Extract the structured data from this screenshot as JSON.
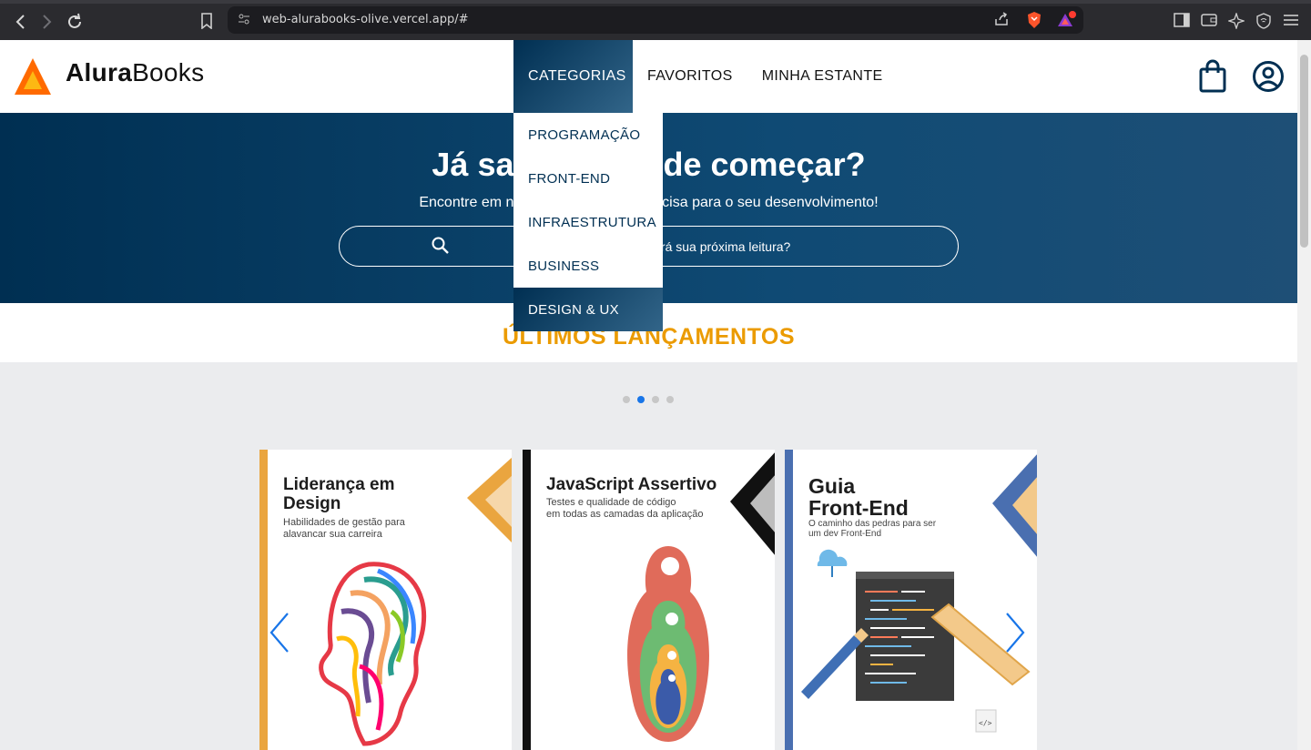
{
  "browser": {
    "url": "web-alurabooks-olive.vercel.app/#"
  },
  "header": {
    "logo_text_bold": "Alura",
    "logo_text_regular": "Books",
    "nav": [
      "CATEGORIAS",
      "FAVORITOS",
      "MINHA ESTANTE"
    ]
  },
  "dropdown": {
    "items": [
      "PROGRAMAÇÃO",
      "FRONT-END",
      "INFRAESTRUTURA",
      "BUSINESS",
      "DESIGN & UX"
    ]
  },
  "hero": {
    "title": "Já sabe por onde começar?",
    "subtitle": "Encontre em nossa estante o que precisa para o seu desenvolvimento!",
    "search_placeholder": "Qual será sua próxima leitura?"
  },
  "releases": {
    "title": "ÚLTIMOS LANÇAMENTOS",
    "active_dot": 1,
    "dot_count": 4,
    "books": [
      {
        "title_line1": "Liderança em",
        "title_line2": "Design",
        "subtitle_line1": "Habilidades de gestão para",
        "subtitle_line2": "alavancar sua carreira",
        "accent": "#eaa53f"
      },
      {
        "title_line1": "JavaScript Assertivo",
        "title_line2": "",
        "subtitle_line1": "Testes e qualidade de código",
        "subtitle_line2": "em todas as camadas da aplicação",
        "accent": "#111111"
      },
      {
        "title_line1": "Guia",
        "title_line2": "Front-End",
        "subtitle_line1": "O caminho das pedras para ser",
        "subtitle_line2": "um dev Front-End",
        "accent": "#4a6fb0"
      }
    ]
  },
  "colors": {
    "brand_dark": "#002f52",
    "brand_accent": "#eb9b00",
    "carousel_arrow": "#1875e8"
  }
}
